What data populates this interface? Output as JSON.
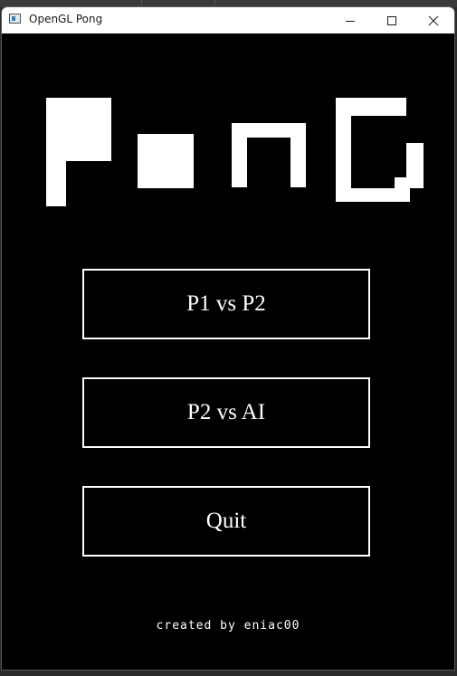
{
  "window": {
    "title": "OpenGL Pong"
  },
  "logo": {
    "text": "PonG"
  },
  "menu": {
    "items": [
      {
        "label": "P1 vs P2"
      },
      {
        "label": "P2 vs AI"
      },
      {
        "label": "Quit"
      }
    ]
  },
  "footer": {
    "credit": "created by eniac00"
  },
  "colors": {
    "background": "#000000",
    "foreground": "#ffffff",
    "titlebar": "#ffffff"
  },
  "icons": {
    "minimize": "minimize-icon",
    "maximize": "maximize-icon",
    "close": "close-icon"
  }
}
